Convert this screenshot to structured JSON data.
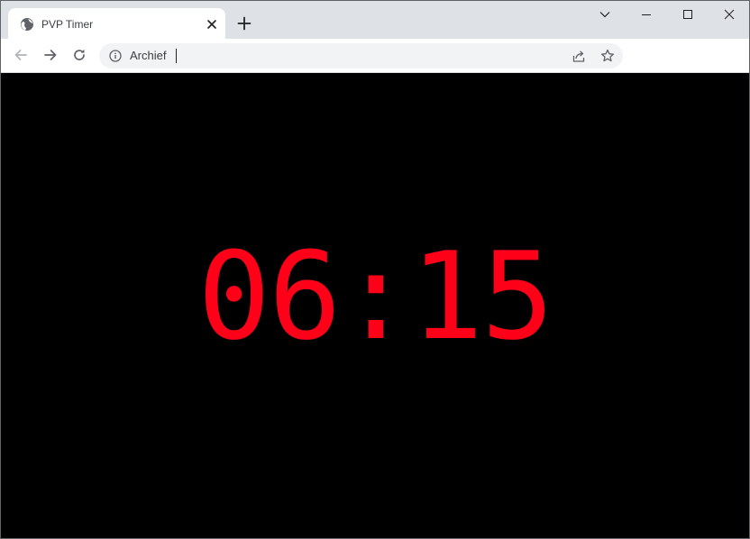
{
  "browser": {
    "tab": {
      "title": "PVP Timer",
      "favicon": "globe-icon"
    },
    "new_tab_icon": "plus-icon",
    "window_controls": [
      "chevron-down-icon",
      "minimize-icon",
      "maximize-icon",
      "close-icon"
    ],
    "address_bar": {
      "security_icon": "info-icon",
      "url": "Archief",
      "actions": [
        "share-icon",
        "star-icon"
      ]
    }
  },
  "page": {
    "timer": "06:15",
    "colors": {
      "background": "#000000",
      "timer_text": "#ff0019"
    }
  }
}
